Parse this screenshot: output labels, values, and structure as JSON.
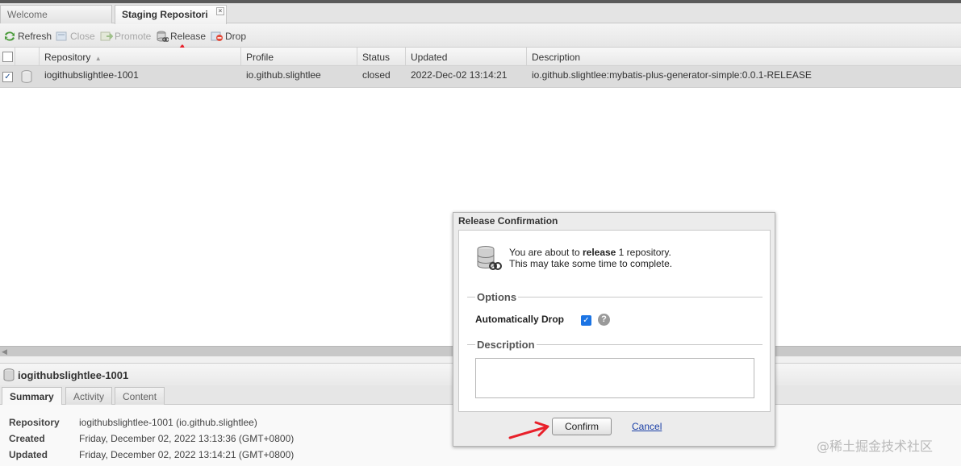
{
  "tabs": [
    {
      "label": "Welcome"
    },
    {
      "label": "Staging Repositori",
      "close": "×"
    }
  ],
  "toolbar": {
    "refresh": "Refresh",
    "close": "Close",
    "promote": "Promote",
    "release": "Release",
    "drop": "Drop"
  },
  "grid": {
    "columns": [
      "Repository",
      "Profile",
      "Status",
      "Updated",
      "Description"
    ],
    "sort_indicator": "▲",
    "rows": [
      {
        "repository": "iogithubslightlee-1001",
        "profile": "io.github.slightlee",
        "status": "closed",
        "updated": "2022-Dec-02 13:14:21",
        "description": "io.github.slightlee:mybatis-plus-generator-simple:0.0.1-RELEASE",
        "checked": "✓"
      }
    ]
  },
  "detail": {
    "title": "iogithubslightlee-1001",
    "tabs": [
      "Summary",
      "Activity",
      "Content"
    ],
    "fields": [
      {
        "label": "Repository",
        "value": "iogithubslightlee-1001 (io.github.slightlee)"
      },
      {
        "label": "Created",
        "value": "Friday, December 02, 2022 13:13:36 (GMT+0800)"
      },
      {
        "label": "Updated",
        "value": "Friday, December 02, 2022 13:14:21 (GMT+0800)"
      }
    ]
  },
  "dialog": {
    "title": "Release Confirmation",
    "msg_prefix": "You are about to ",
    "msg_action": "release",
    "msg_suffix": " 1 repository.",
    "msg_line2": "This may take some time to complete.",
    "options_legend": "Options",
    "auto_drop_label": "Automatically Drop",
    "auto_drop_check": "✓",
    "help": "?",
    "description_legend": "Description",
    "confirm": "Confirm",
    "cancel": "Cancel"
  },
  "watermark": "@稀土掘金技术社区",
  "colors": {
    "annotation_arrow": "#e8202a",
    "checkbox_checked": "#1b74e4",
    "link": "#1a3fa6"
  }
}
